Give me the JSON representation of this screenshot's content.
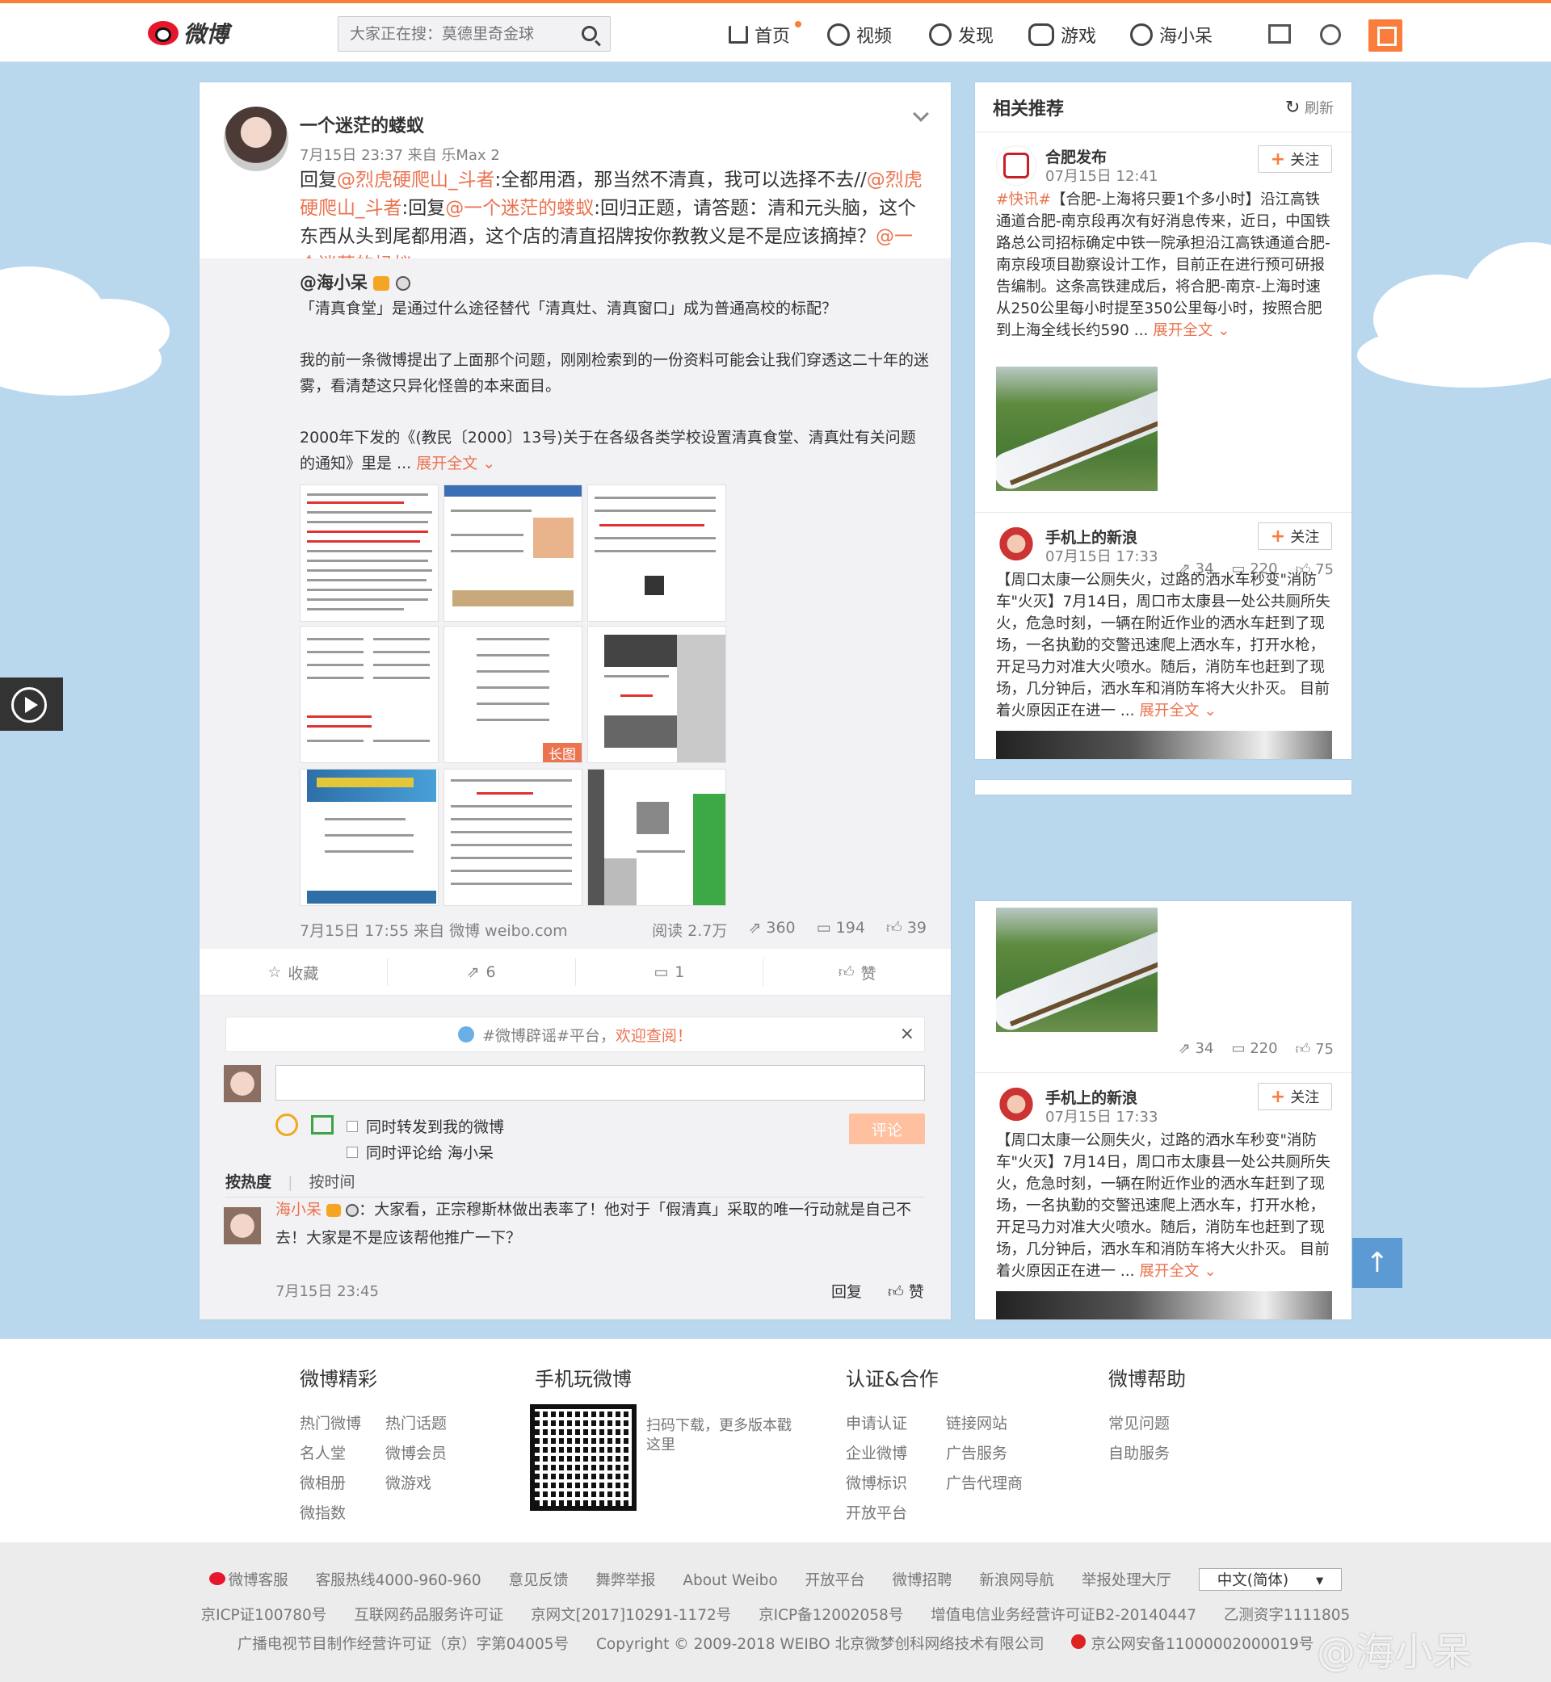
{
  "topbar": {
    "logo_text": "微博",
    "search_placeholder": "大家正在搜：莫德里奇金球",
    "nav": [
      "首页",
      "视频",
      "发现",
      "游戏",
      "海小呆"
    ]
  },
  "post": {
    "user": "一个迷茫的蝼蚁",
    "time": "7月15日 23:37 来自 乐Max 2",
    "text_parts": [
      "回复",
      "@烈虎硬爬山_斗者",
      ":全都用酒，那当然不清真，我可以选择不去//",
      "@烈虎硬爬山_斗者",
      ":回复",
      "@一个迷茫的蝼蚁",
      ":回归正题，请答题：清和元头脑，这个东西从头到尾都用酒，这个店的清直招牌按你教教义是不是应该摘掉？",
      "@一个迷茫的蚂蚁"
    ]
  },
  "quote": {
    "user": "@海小呆",
    "para1": "「清真食堂」是通过什么途径替代「清真灶、清真窗口」成为普通高校的标配？",
    "para2": "我的前一条微博提出了上面那个问题，刚刚检索到的一份资料可能会让我们穿透这二十年的迷雾，看清楚这只异化怪兽的本来面目。",
    "para3": "2000年下发的《(教民〔2000〕13号)关于在各级各类学校设置清真食堂、清真灶有关问题的通知》里是 ...",
    "expand": "展开全文",
    "long_badge": "长图",
    "meta": "7月15日 17:55 来自 微博 weibo.com",
    "reads": "阅读 2.7万",
    "reposts": "360",
    "comments": "194",
    "likes": "39"
  },
  "actions": {
    "fav": "收藏",
    "repost": "6",
    "comment": "1",
    "like": "赞"
  },
  "comment_box": {
    "notice": "#微博辟谣#平台，",
    "notice_link": "欢迎查阅！",
    "chk1": "同时转发到我的微博",
    "chk2": "同时评论给 海小呆",
    "submit": "评论",
    "sort_hot": "按热度",
    "sort_time": "按时间"
  },
  "comment": {
    "user": "海小呆",
    "text": "：大家看，正宗穆斯林做出表率了！他对于「假清真」采取的唯一行动就是自己不去！大家是不是应该帮他推广一下？",
    "time": "7月15日 23:45",
    "reply": "回复",
    "like": "赞"
  },
  "sidebar": {
    "title": "相关推荐",
    "refresh": "刷新",
    "follow": "关注",
    "item1": {
      "name": "合肥发布",
      "time": "07月15日 12:41",
      "tag": "#快讯#",
      "text": "【合肥-上海将只要1个多小时】沿江高铁通道合肥-南京段再次有好消息传来，近日，中国铁路总公司招标确定中铁一院承担沿江高铁通道合肥-南京段项目勘察设计工作，目前正在进行预可研报告编制。这条高铁建成后，将合肥-南京-上海时速从250公里每小时提至350公里每小时，按照合肥到上海全线长约590 ...",
      "expand": "展开全文",
      "reposts": "34",
      "comments": "220",
      "likes": "75"
    },
    "item2": {
      "name": "手机上的新浪",
      "time": "07月15日 17:33",
      "text": "【周口太康一公厕失火，过路的洒水车秒变\"消防车\"火灭】7月14日，周口市太康县一处公共厕所失火，危急时刻，一辆在附近作业的洒水车赶到了现场，一名执勤的交警迅速爬上洒水车，打开水枪，开足马力对准大火喷水。随后，消防车也赶到了现场，几分钟后，洒水车和消防车将大火扑灭。 目前着火原因正在进一 ...",
      "expand": "展开全文"
    }
  },
  "footer": {
    "col1_title": "微博精彩",
    "col1_links": [
      "热门微博",
      "热门话题",
      "名人堂",
      "微博会员",
      "微相册",
      "微游戏",
      "微指数"
    ],
    "col2_title": "手机玩微博",
    "col2_text": "扫码下载，更多版本戳这里",
    "col3_title": "认证&合作",
    "col3_links": [
      "申请认证",
      "链接网站",
      "企业微博",
      "广告服务",
      "微博标识",
      "广告代理商",
      "开放平台"
    ],
    "col4_title": "微博帮助",
    "col4_links": [
      "常见问题",
      "自助服务"
    ],
    "row1": [
      "微博客服",
      "客服热线4000-960-960",
      "意见反馈",
      "舞弊举报",
      "About Weibo",
      "开放平台",
      "微博招聘",
      "新浪网导航",
      "举报处理大厅"
    ],
    "lang": "中文(简体)",
    "row2": [
      "京ICP证100780号",
      "互联网药品服务许可证",
      "京网文[2017]10291-1172号",
      "京ICP备12002058号",
      "增值电信业务经营许可证B2-20140447",
      "乙测资字1111805"
    ],
    "row3": [
      "广播电视节目制作经营许可证（京）字第04005号",
      "Copyright © 2009-2018 WEIBO 北京微梦创科网络技术有限公司",
      "京公网安备11000002000019号"
    ]
  },
  "watermark": "@海小呆",
  "colors": {
    "accent": "#fa7d3c",
    "link": "#eb7350",
    "bg": "#b9d8ee"
  }
}
